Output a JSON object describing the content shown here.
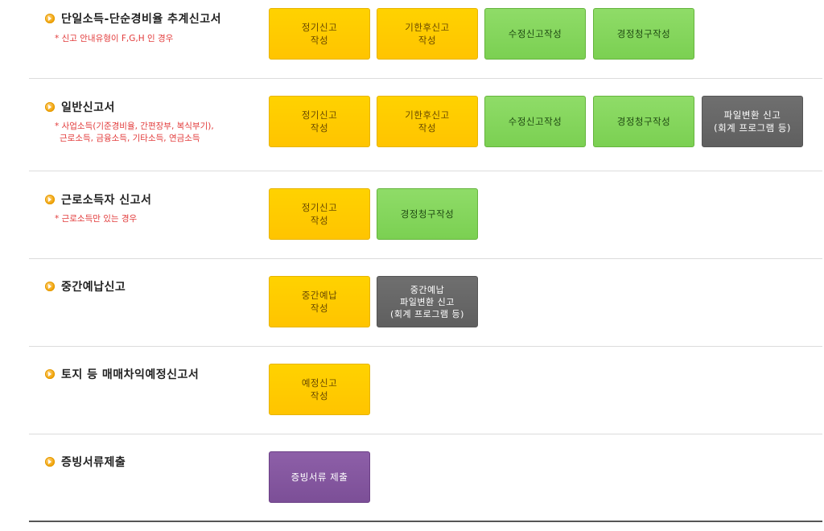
{
  "sections": [
    {
      "title": "단일소득-단순경비율 추계신고서",
      "note": "* 신고 안내유형이 F,G,H 인 경우",
      "buttons": [
        "정기신고\n작성",
        "기한후신고\n작성",
        "수정신고작성",
        "경정청구작성"
      ]
    },
    {
      "title": "일반신고서",
      "note_lines": [
        "* 사업소득(기준경비율, 간편장부, 복식부기),",
        "근로소득, 금융소득, 기타소득, 연금소득"
      ],
      "buttons": [
        "정기신고\n작성",
        "기한후신고\n작성",
        "수정신고작성",
        "경정청구작성",
        "파일변환 신고\n(회계 프로그램 등)"
      ]
    },
    {
      "title": "근로소득자 신고서",
      "note": "* 근로소득만 있는 경우",
      "buttons": [
        "정기신고\n작성",
        "경정청구작성"
      ]
    },
    {
      "title": "중간예납신고",
      "buttons": [
        "중간예납\n작성",
        "중간예납\n파일변환 신고\n(회계 프로그램 등)"
      ]
    },
    {
      "title": "토지 등 매매차익예정신고서",
      "buttons": [
        "예정신고\n작성"
      ]
    },
    {
      "title": "증빙서류제출",
      "buttons": [
        "증빙서류 제출"
      ]
    }
  ],
  "colors": {
    "yellow": "#ffc800",
    "green": "#7fd356",
    "gray": "#666666",
    "purple": "#83559f",
    "note_red": "#e23b3b",
    "bullet_orange": "#f0a000"
  },
  "icons": {
    "bullet": "orange-circle-arrow-icon"
  }
}
